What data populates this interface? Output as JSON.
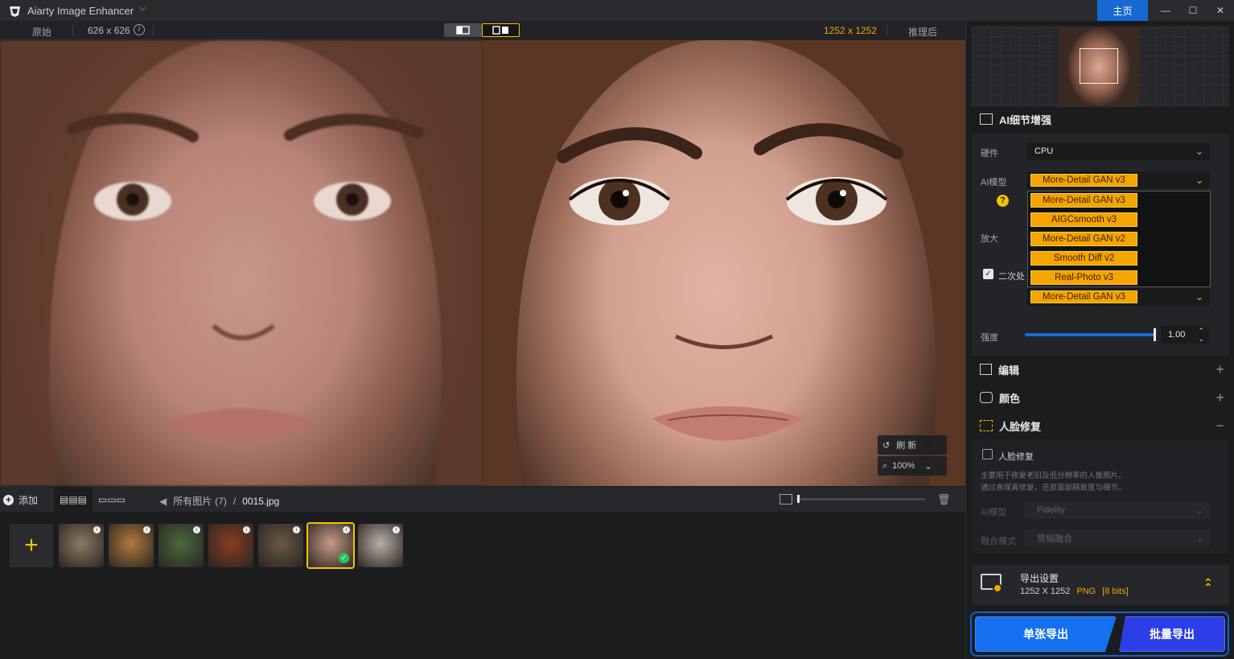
{
  "app": {
    "title": "Aiarty Image Enhancer",
    "home_label": "主页"
  },
  "window": {
    "min": "—",
    "max": "☐",
    "close": "✕"
  },
  "compare": {
    "original_label": "原始",
    "original_size": "626 x 626",
    "output_size": "1252 x 1252",
    "after_label": "推理后"
  },
  "zoom": {
    "refresh_label": "刷  新",
    "zoom_level": "100%"
  },
  "strip": {
    "add_label": "添加",
    "folder": "所有图片",
    "count": "(7)",
    "separator": "/",
    "file": "0015.jpg",
    "thumbnails": [
      {
        "name": "owl",
        "color": "#8a7a66"
      },
      {
        "name": "tiger",
        "color": "#b27a3a"
      },
      {
        "name": "forest",
        "color": "#4b6a3c"
      },
      {
        "name": "burger",
        "color": "#8a3d22"
      },
      {
        "name": "dog",
        "color": "#6a5845"
      },
      {
        "name": "portrait",
        "color": "#c89a86"
      },
      {
        "name": "statue",
        "color": "#b8aea6"
      }
    ]
  },
  "panel": {
    "ai_section": "AI细节增强",
    "hardware_label": "硬件",
    "hardware_value": "CPU",
    "model_label": "AI模型",
    "model_value": "More-Detail GAN  v3",
    "model_options": [
      "More-Detail GAN  v3",
      "AIGCsmooth  v3",
      "More-Detail GAN  v2",
      "Smooth Diff  v2",
      "Real-Photo  v3"
    ],
    "scale_label": "放大",
    "second_label": "二次处",
    "second_model": "More-Detail GAN  v3",
    "strength_label": "强度",
    "strength_value": "1.00",
    "strength": 1.0,
    "edit_section": "编辑",
    "color_section": "颜色",
    "face_section": "人脸修复",
    "face_checkbox_label": "人脸修复",
    "face_desc_1": "主要用于修复老旧及低分辨率的人像照片。",
    "face_desc_2": "通过高保真修复，还原面部精致度与细节。",
    "face_model_label": "AI模型",
    "face_model_value": "Fidelity",
    "blend_label": "融合模式",
    "blend_value": "常规融合",
    "export_title": "导出设置",
    "export_size": "1252 X 1252",
    "export_format": "PNG",
    "export_bits": "[8 bits]",
    "single_export": "单张导出",
    "batch_export": "批量导出"
  }
}
